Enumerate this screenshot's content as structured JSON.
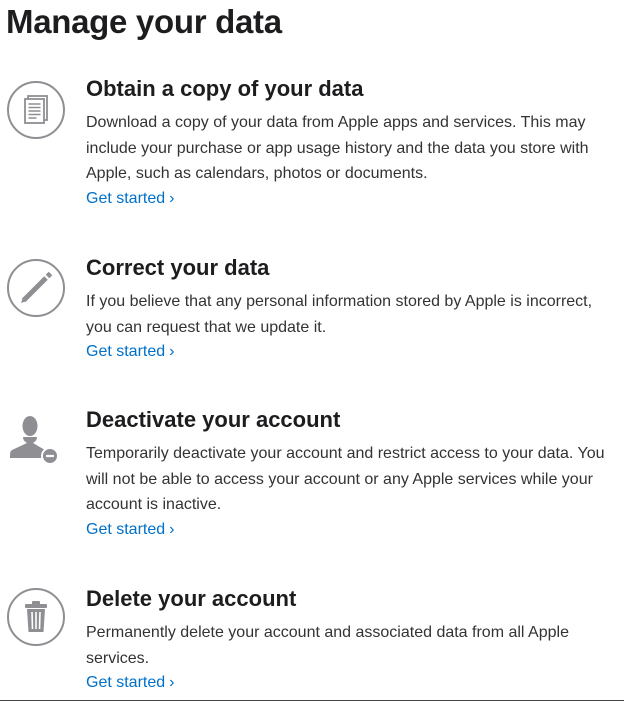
{
  "page": {
    "title": "Manage your data"
  },
  "sections": [
    {
      "icon": "documents-icon",
      "title": "Obtain a copy of your data",
      "description": "Download a copy of your data from Apple apps and services. This may include your purchase or app usage history and the data you store with Apple, such as calendars, photos or documents.",
      "link": "Get started",
      "chevron": "›"
    },
    {
      "icon": "pencil-icon",
      "title": "Correct your data",
      "description": "If you believe that any personal information stored by Apple is incorrect, you can request that we update it.",
      "link": "Get started",
      "chevron": "›"
    },
    {
      "icon": "user-remove-icon",
      "title": "Deactivate your account",
      "description": "Temporarily deactivate your account and restrict access to your data. You will not be able to access your account or any Apple services while your account is inactive.",
      "link": "Get started",
      "chevron": "›"
    },
    {
      "icon": "trash-icon",
      "title": "Delete your account",
      "description": "Permanently delete your account and associated data from all Apple services.",
      "link": "Get started",
      "chevron": "›"
    }
  ],
  "colors": {
    "link": "#0070c9",
    "icon": "#8e8e93",
    "text": "#333333",
    "heading": "#1d1d1f"
  }
}
